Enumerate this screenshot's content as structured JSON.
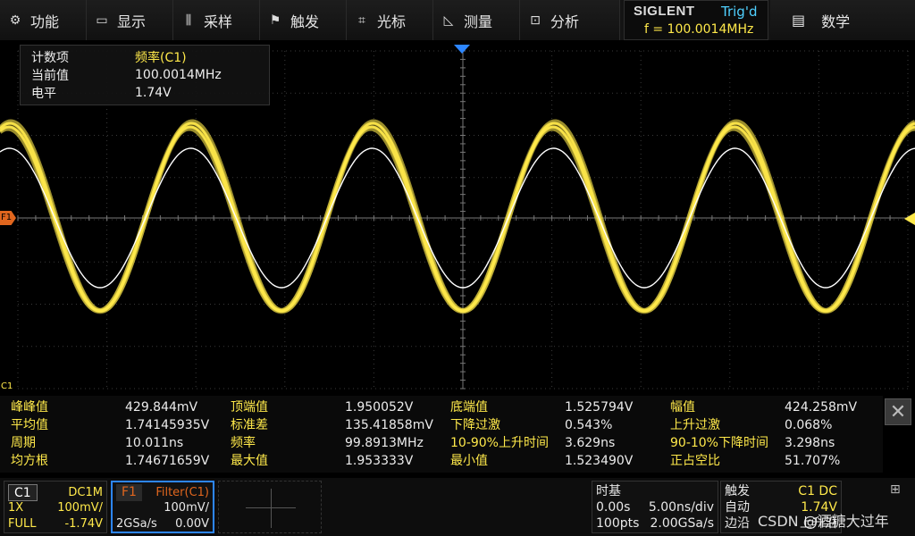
{
  "menu": [
    {
      "label": "功能",
      "icon": "gear-icon"
    },
    {
      "label": "显示",
      "icon": "display-icon"
    },
    {
      "label": "采样",
      "icon": "acquire-icon"
    },
    {
      "label": "触发",
      "icon": "flag-icon"
    },
    {
      "label": "光标",
      "icon": "cursor-icon"
    },
    {
      "label": "测量",
      "icon": "measure-icon"
    },
    {
      "label": "分析",
      "icon": "analyze-icon"
    }
  ],
  "brand": "SIGLENT",
  "trigger_status": "Trig'd",
  "trigger_frequency": "f = 100.0014MHz",
  "math_label": "数学",
  "counter": {
    "rows": [
      {
        "key": "计数项",
        "value": "频率(C1)"
      },
      {
        "key": "当前值",
        "value": "100.0014MHz"
      },
      {
        "key": "电平",
        "value": "1.74V"
      }
    ]
  },
  "markers": {
    "f1": "F1",
    "c1": "C1"
  },
  "measurements": [
    [
      {
        "label": "峰峰值",
        "value": "429.844mV"
      },
      {
        "label": "顶端值",
        "value": "1.950052V"
      },
      {
        "label": "底端值",
        "value": "1.525794V"
      },
      {
        "label": "幅值",
        "value": "424.258mV"
      }
    ],
    [
      {
        "label": "平均值",
        "value": "1.74145935V"
      },
      {
        "label": "标准差",
        "value": "135.41858mV"
      },
      {
        "label": "下降过激",
        "value": "0.543%"
      },
      {
        "label": "上升过激",
        "value": "0.068%"
      }
    ],
    [
      {
        "label": "周期",
        "value": "10.011ns"
      },
      {
        "label": "频率",
        "value": "99.8913MHz"
      },
      {
        "label": "10-90%上升时间",
        "value": "3.629ns"
      },
      {
        "label": "90-10%下降时间",
        "value": "3.298ns"
      }
    ],
    [
      {
        "label": "均方根",
        "value": "1.74671659V"
      },
      {
        "label": "最大值",
        "value": "1.953333V"
      },
      {
        "label": "最小值",
        "value": "1.523490V"
      },
      {
        "label": "正占空比",
        "value": "51.707%"
      }
    ]
  ],
  "channel_c1": {
    "tag": "C1",
    "coupling": "DC1M",
    "probe": "1X",
    "scale": "100mV/",
    "bandwidth": "FULL",
    "offset": "-1.74V"
  },
  "channel_f1": {
    "tag": "F1",
    "source": "Filter(C1)",
    "scale": "100mV/",
    "rate": "2GSa/s",
    "offset": "0.00V"
  },
  "timebase": {
    "title": "时基",
    "delay": "0.00s",
    "scale": "5.00ns/div",
    "points": "100pts",
    "rate": "2.00GSa/s"
  },
  "trigger": {
    "title": "触发",
    "source": "C1 DC",
    "mode": "自动",
    "level": "1.74V",
    "type": "边沿",
    "slope": "上升沿"
  },
  "watermark": "CSDN @酒糖大过年",
  "colors": {
    "ch1": "#ffe94a",
    "filter": "#ffffff",
    "f1": "#e0661e",
    "accent": "#2d86ff"
  }
}
